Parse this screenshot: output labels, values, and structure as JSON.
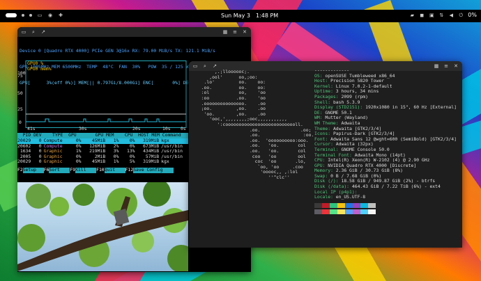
{
  "topbar": {
    "date": "Sun May 3",
    "time": "1:48 PM",
    "battery": "0%"
  },
  "nvtop": {
    "line1": "Device 0 [Quadro RTX 4000] PCIe GEN 3@16x RX: 79.00 MiB/s TX: 121.1 MiB/s",
    "line2": "GPU 1005MHz MEM 6500MHz  TEMP  48°C  FAN  30%   POW  35 / 125 W",
    "line3": "GPU[      3%(eff 0%)] MEM[|| 0.797Gi/8.000Gi] ENC[       0%] DEC[     0%]",
    "graph_y": [
      "100",
      "75",
      "50",
      "25",
      "0"
    ],
    "graph_legend": [
      "GPU0 %",
      "GPU0 mem%"
    ],
    "graph_x": [
      "41s",
      "30s",
      "20s",
      "10s",
      "0s"
    ]
  },
  "procs": {
    "header": "  PID DEV    TYPE  GPU       GPU MEM    CPU  HOST MEM Command",
    "rows": [
      {
        "pid": "20029",
        "dev": "0",
        "type": "Compute",
        "gpu": "0%",
        "gmem": "45MiB",
        "gmp": "1%",
        "cpu": "0%",
        "hmem": "319MiB",
        "cmd": "kgx",
        "sel": true
      },
      {
        "pid": "20602",
        "dev": "0",
        "type": "Compute",
        "gpu": "0%",
        "gmem": "126MiB",
        "gmp": "2%",
        "cpu": "0%",
        "hmem": "673MiB",
        "cmd": "/usr/bin",
        "sel": false
      },
      {
        "pid": "1634",
        "dev": "0",
        "type": "Graphic",
        "gpu": "1%",
        "gmem": "219MiB",
        "gmp": "3%",
        "cpu": "13%",
        "hmem": "434MiB",
        "cmd": "/usr/bin",
        "sel": false
      },
      {
        "pid": "2005",
        "dev": "0",
        "type": "Graphic",
        "gpu": "0%",
        "gmem": "2MiB",
        "gmp": "0%",
        "cpu": "0%",
        "hmem": "57MiB",
        "cmd": "/usr/bin",
        "sel": false
      },
      {
        "pid": "20029",
        "dev": "0",
        "type": "Graphic",
        "gpu": "0%",
        "gmem": "45MiB",
        "gmp": "1%",
        "cpu": "5%",
        "hmem": "319MiB",
        "cmd": "kgx",
        "sel": false
      }
    ],
    "keys": [
      {
        "k": "F2",
        "v": "Setup"
      },
      {
        "k": "F6",
        "v": "Sort"
      },
      {
        "k": "F9",
        "v": "Kill"
      },
      {
        "k": "F10",
        "v": "Quit"
      },
      {
        "k": "F12",
        "v": "Save Config"
      }
    ]
  },
  "fetch": {
    "logo": [
      "       ,.;lloooooc;.",
      "     ,ool'      oo,;oo:",
      "   .lo'         oo.    oo:",
      "  .oo.          oo.    oo:",
      "  :ol           oo,    'oo",
      "  :oo          .oo.    'oo",
      "  .ooooooooooooooo.    .oo",
      "  ;oo.         ,oo.    .oo",
      "   'oo.        ,oo.    .oo",
      "     'ooc,',,,,,,,,;ooc,,,,,,,,,,,",
      "        ':cooooooooooooooooooooooooooll.",
      "                    .oo.               .oo;",
      "                    .oo.                :oo.",
      "                    .oo.  'oooooooooo:ooo.",
      "                    .oo.   'oo.       col",
      "                    .oo.   'oo.       col",
      "                     coo   'oo        ool",
      "                      coc  'oo       .lo,",
      "                       `oo, 'oo     .coo",
      "                        'ooooc,, ,:lol",
      "                           ''^clc''"
    ],
    "title": "-------------",
    "info": [
      {
        "l": "OS",
        "v": "openSUSE Tumbleweed x86_64"
      },
      {
        "l": "Host",
        "v": "Precision 5820 Tower"
      },
      {
        "l": "Kernel",
        "v": "Linux 7.0.2-1-default"
      },
      {
        "l": "Uptime",
        "v": "3 hours, 34 mins"
      },
      {
        "l": "Packages",
        "v": "2099 (rpm)"
      },
      {
        "l": "Shell",
        "v": "bash 5.3.9"
      },
      {
        "l": "Display (STD2151)",
        "v": "1920x1080 in 15\", 60 Hz [External]"
      },
      {
        "l": "DE",
        "v": "GNOME 50.1"
      },
      {
        "l": "WM",
        "v": "Mutter (Wayland)"
      },
      {
        "l": "WM Theme",
        "v": "Adwaita"
      },
      {
        "l": "Theme",
        "v": "Adwaita [GTK2/3/4]"
      },
      {
        "l": "Icons",
        "v": "Papirus-Dark [GTK2/3/4]"
      },
      {
        "l": "Font",
        "v": "Adwaita Sans 12 @wght=600 (SemiBold) [GTK2/3/4]"
      },
      {
        "l": "Cursor",
        "v": "Adwaita (32px)"
      },
      {
        "l": "Terminal",
        "v": "GNOME Console 50.0"
      },
      {
        "l": "Terminal Font",
        "v": "Adwaita Mono (14pt)"
      },
      {
        "l": "CPU",
        "v": "Intel(R) Xeon(R) W-2102 (4) @ 2.90 GHz"
      },
      {
        "l": "GPU",
        "v": "NVIDIA Quadro RTX 4000 [Discrete]"
      },
      {
        "l": "Memory",
        "v": "2.36 GiB / 30.73 GiB (8%)"
      },
      {
        "l": "Swap",
        "v": "0 B / 7.68 GiB (0%)"
      },
      {
        "l": "Disk (/)",
        "v": "18.58 GiB / 949.87 GiB (2%) - btrfs"
      },
      {
        "l": "Disk (/data)",
        "v": "464.43 GiB / 7.22 TiB (6%) - ext4"
      },
      {
        "l": "Local IP (p4p1)",
        "v": ""
      },
      {
        "l": "Locale",
        "v": "en_US.UTF-8"
      }
    ],
    "colors": [
      "#3a3a3a",
      "#c01c28",
      "#2ec27e",
      "#f5c211",
      "#1e78e4",
      "#9841bb",
      "#0ab9dc",
      "#c0bfbc",
      "#5e5c64",
      "#ed333b",
      "#57e389",
      "#f8e45c",
      "#51a1ff",
      "#c061cb",
      "#4fd2fd",
      "#f6f5f4"
    ]
  }
}
